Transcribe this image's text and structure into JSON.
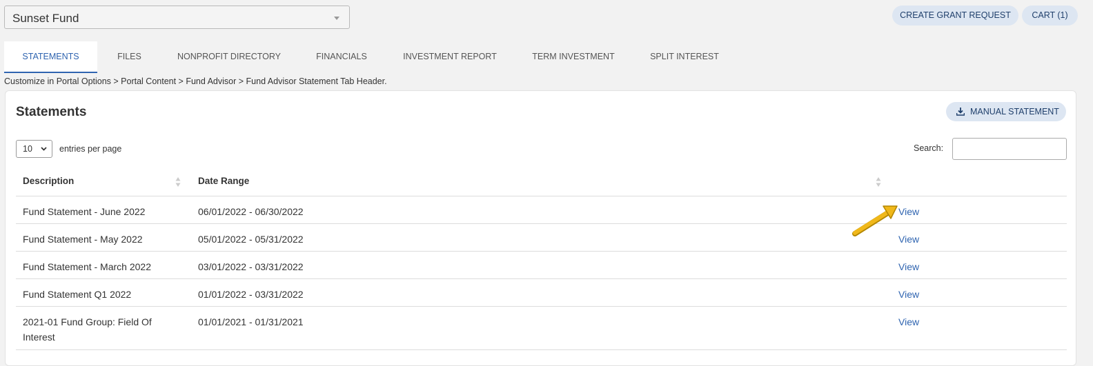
{
  "fund_selector": {
    "value": "Sunset Fund"
  },
  "header_buttons": {
    "create_grant": "CREATE GRANT REQUEST",
    "cart": "CART (1)"
  },
  "tabs": [
    {
      "label": "STATEMENTS",
      "active": true
    },
    {
      "label": "FILES"
    },
    {
      "label": "NONPROFIT DIRECTORY"
    },
    {
      "label": "FINANCIALS"
    },
    {
      "label": "INVESTMENT REPORT"
    },
    {
      "label": "TERM INVESTMENT"
    },
    {
      "label": "SPLIT INTEREST"
    }
  ],
  "hint_text": "Customize in Portal Options > Portal Content > Fund Advisor > Fund Advisor Statement Tab Header.",
  "statements": {
    "title": "Statements",
    "manual_button": "MANUAL STATEMENT",
    "per_page": {
      "value": "10",
      "label": "entries per page"
    },
    "search": {
      "label": "Search:",
      "value": "",
      "placeholder": ""
    },
    "columns": [
      "Description",
      "Date Range"
    ],
    "rows": [
      {
        "description": "Fund Statement - June 2022",
        "date_range": "06/01/2022 - 06/30/2022",
        "action": "View"
      },
      {
        "description": "Fund Statement - May 2022",
        "date_range": "05/01/2022 - 05/31/2022",
        "action": "View"
      },
      {
        "description": "Fund Statement - March 2022",
        "date_range": "03/01/2022 - 03/31/2022",
        "action": "View"
      },
      {
        "description": "Fund Statement Q1 2022",
        "date_range": "01/01/2022 - 03/31/2022",
        "action": "View"
      },
      {
        "description": "2021-01 Fund Group: Field Of Interest",
        "date_range": "01/01/2021 - 01/31/2021",
        "action": "View"
      }
    ]
  },
  "colors": {
    "accent": "#2f64b0",
    "pill_bg": "#dde6f2",
    "arrow": "#f0b81a"
  }
}
